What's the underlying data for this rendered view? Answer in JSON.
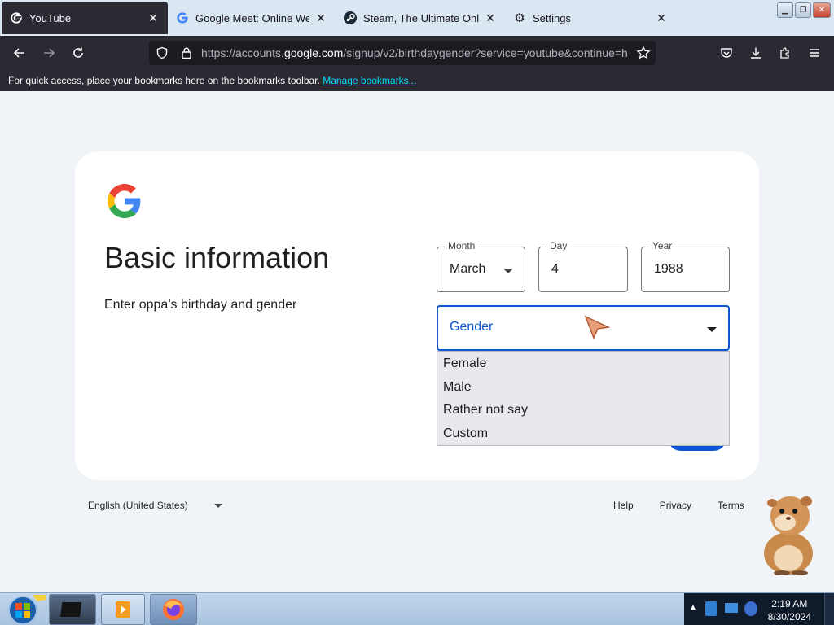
{
  "browser": {
    "tabs": [
      {
        "title": "YouTube",
        "icon": "google-g-icon",
        "active": true
      },
      {
        "title": "Google Meet: Online Web an",
        "icon": "google-g-icon",
        "active": false
      },
      {
        "title": "Steam, The Ultimate Online",
        "icon": "steam-icon",
        "active": false
      },
      {
        "title": "Settings",
        "icon": "gear-icon",
        "active": false
      }
    ],
    "url_prefix": "https://accounts.",
    "url_domain": "google.com",
    "url_suffix": "/signup/v2/birthdaygender?service=youtube&continue=h",
    "bookmarks_text": "For quick access, place your bookmarks here on the bookmarks toolbar.",
    "bookmarks_link": "Manage bookmarks..."
  },
  "page": {
    "heading": "Basic information",
    "subheading": "Enter oppa’s birthday and gender",
    "month": {
      "label": "Month",
      "value": "March"
    },
    "day": {
      "label": "Day",
      "value": "4"
    },
    "year": {
      "label": "Year",
      "value": "1988"
    },
    "gender": {
      "placeholder": "Gender"
    },
    "gender_options": [
      "Female",
      "Male",
      "Rather not say",
      "Custom"
    ]
  },
  "footer": {
    "language": "English (United States)",
    "links": [
      "Help",
      "Privacy",
      "Terms"
    ]
  },
  "taskbar": {
    "time": "2:19 AM",
    "date": "8/30/2024"
  },
  "colors": {
    "accent": "#0b57d0",
    "browser_dark": "#2b2a33",
    "page_bg": "#f0f4f9"
  }
}
